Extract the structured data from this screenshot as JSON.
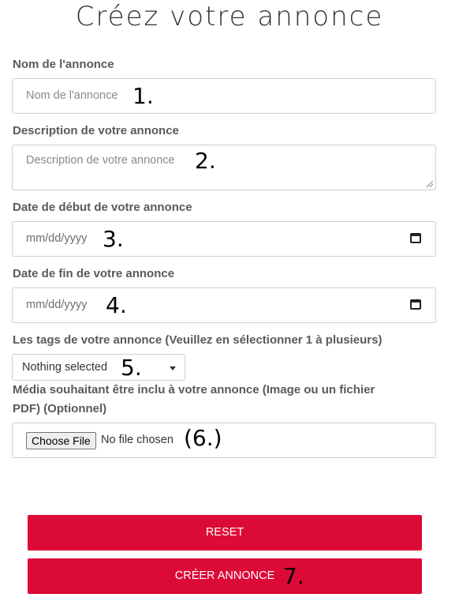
{
  "page": {
    "title": "Créez votre annonce"
  },
  "form": {
    "name": {
      "label": "Nom de l'annonce",
      "placeholder": "Nom de l'annonce",
      "marker": "1."
    },
    "description": {
      "label": "Description de votre annonce",
      "placeholder": "Description de votre annonce",
      "marker": "2."
    },
    "start_date": {
      "label": "Date de début de votre annonce",
      "placeholder": "mm/dd/yyyy",
      "marker": "3."
    },
    "end_date": {
      "label": "Date de fin de votre annonce",
      "placeholder": "mm/dd/yyyy",
      "marker": "4."
    },
    "tags": {
      "label": "Les tags de votre annonce (Veuillez en sélectionner 1 à plusieurs)",
      "selected": "Nothing selected",
      "marker": "5."
    },
    "media": {
      "label_line1": "Média souhaitant être inclu à votre annonce (Image ou un fichier",
      "label_line2": "PDF) (Optionnel)",
      "button": "Choose File",
      "status": "No file chosen",
      "marker": "(6.)"
    }
  },
  "buttons": {
    "reset": "RESET",
    "create": "CRÉER ANNONCE",
    "create_marker": "7."
  },
  "colors": {
    "accent": "#dc0a36",
    "label": "#5a5a5a",
    "title": "#2d3338"
  },
  "icons": {
    "date": "calendar-icon",
    "select": "caret-down-icon"
  }
}
